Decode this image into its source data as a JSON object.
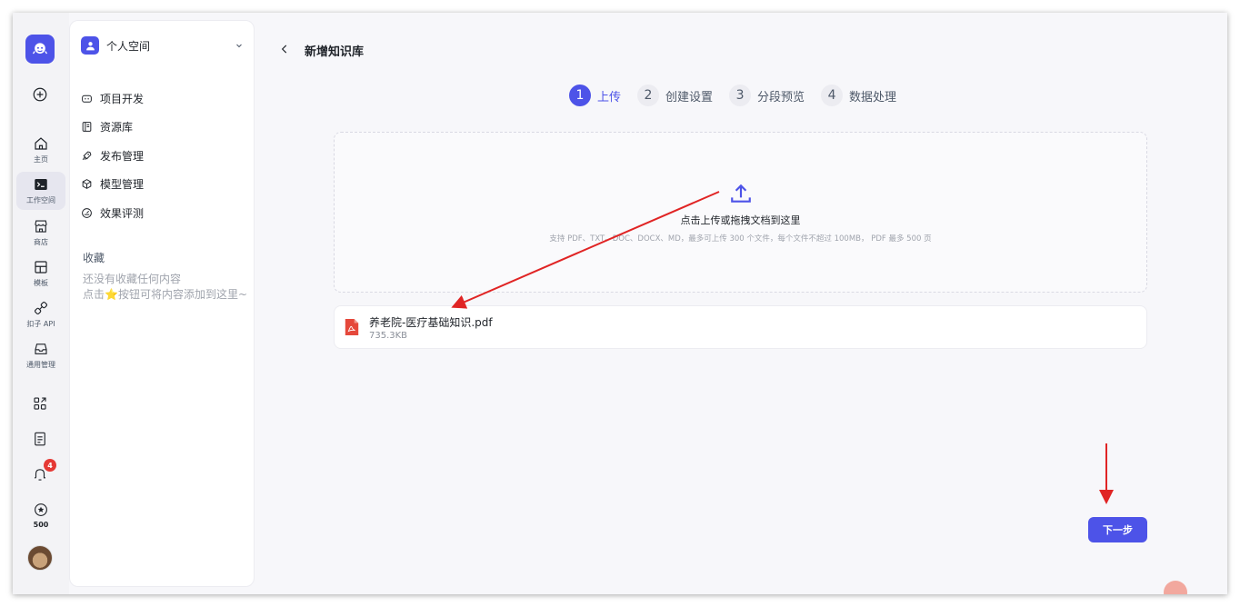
{
  "rail": {
    "items": [
      {
        "id": "home",
        "label": "主页",
        "icon": "home-icon"
      },
      {
        "id": "workspace",
        "label": "工作空间",
        "icon": "terminal-icon",
        "active": true
      },
      {
        "id": "store",
        "label": "商店",
        "icon": "store-icon"
      },
      {
        "id": "templates",
        "label": "模板",
        "icon": "layout-icon"
      },
      {
        "id": "api",
        "label": "扣子 API",
        "icon": "api-icon"
      },
      {
        "id": "general",
        "label": "通用管理",
        "icon": "inbox-icon"
      }
    ],
    "notification_count": "4",
    "points_label": "500"
  },
  "sidebar": {
    "space_name": "个人空间",
    "nav": [
      {
        "label": "项目开发",
        "icon": "bot-icon"
      },
      {
        "label": "资源库",
        "icon": "library-icon"
      },
      {
        "label": "发布管理",
        "icon": "rocket-icon"
      },
      {
        "label": "模型管理",
        "icon": "cube-icon"
      },
      {
        "label": "效果评测",
        "icon": "gauge-icon"
      }
    ],
    "favorites_title": "收藏",
    "favorites_empty_line1": "还没有收藏任何内容",
    "favorites_empty_line2": "点击⭐按钮可将内容添加到这里~"
  },
  "main": {
    "title": "新增知识库",
    "steps": [
      {
        "num": "1",
        "label": "上传",
        "active": true
      },
      {
        "num": "2",
        "label": "创建设置",
        "active": false
      },
      {
        "num": "3",
        "label": "分段预览",
        "active": false
      },
      {
        "num": "4",
        "label": "数据处理",
        "active": false
      }
    ],
    "dropzone": {
      "title": "点击上传或拖拽文档到这里",
      "subtitle": "支持 PDF、TXT、DOC、DOCX、MD，最多可上传 300 个文件，每个文件不超过 100MB， PDF 最多 500 页"
    },
    "file": {
      "name": "养老院-医疗基础知识.pdf",
      "size": "735.3KB"
    },
    "next_button": "下一步"
  },
  "colors": {
    "accent": "#4d53e8",
    "annotation_arrow": "#e02424",
    "pdf_red": "#e5483b"
  }
}
